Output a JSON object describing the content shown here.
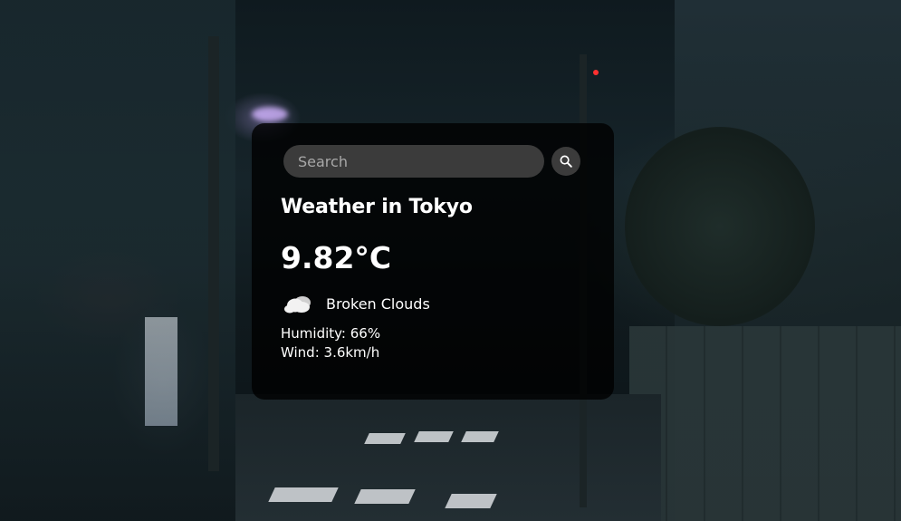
{
  "search": {
    "placeholder": "Search",
    "value": ""
  },
  "weather": {
    "city_title": "Weather in Tokyo",
    "temperature": "9.82°C",
    "description": "Broken Clouds",
    "humidity": "Humidity: 66%",
    "wind": "Wind: 3.6km/h"
  },
  "icons": {
    "search": "search-icon",
    "condition": "broken-clouds-icon"
  },
  "colors": {
    "card_background": "#000000",
    "input_background": "#3b3b3b",
    "text": "#ffffff",
    "placeholder": "#a8a8a8"
  }
}
